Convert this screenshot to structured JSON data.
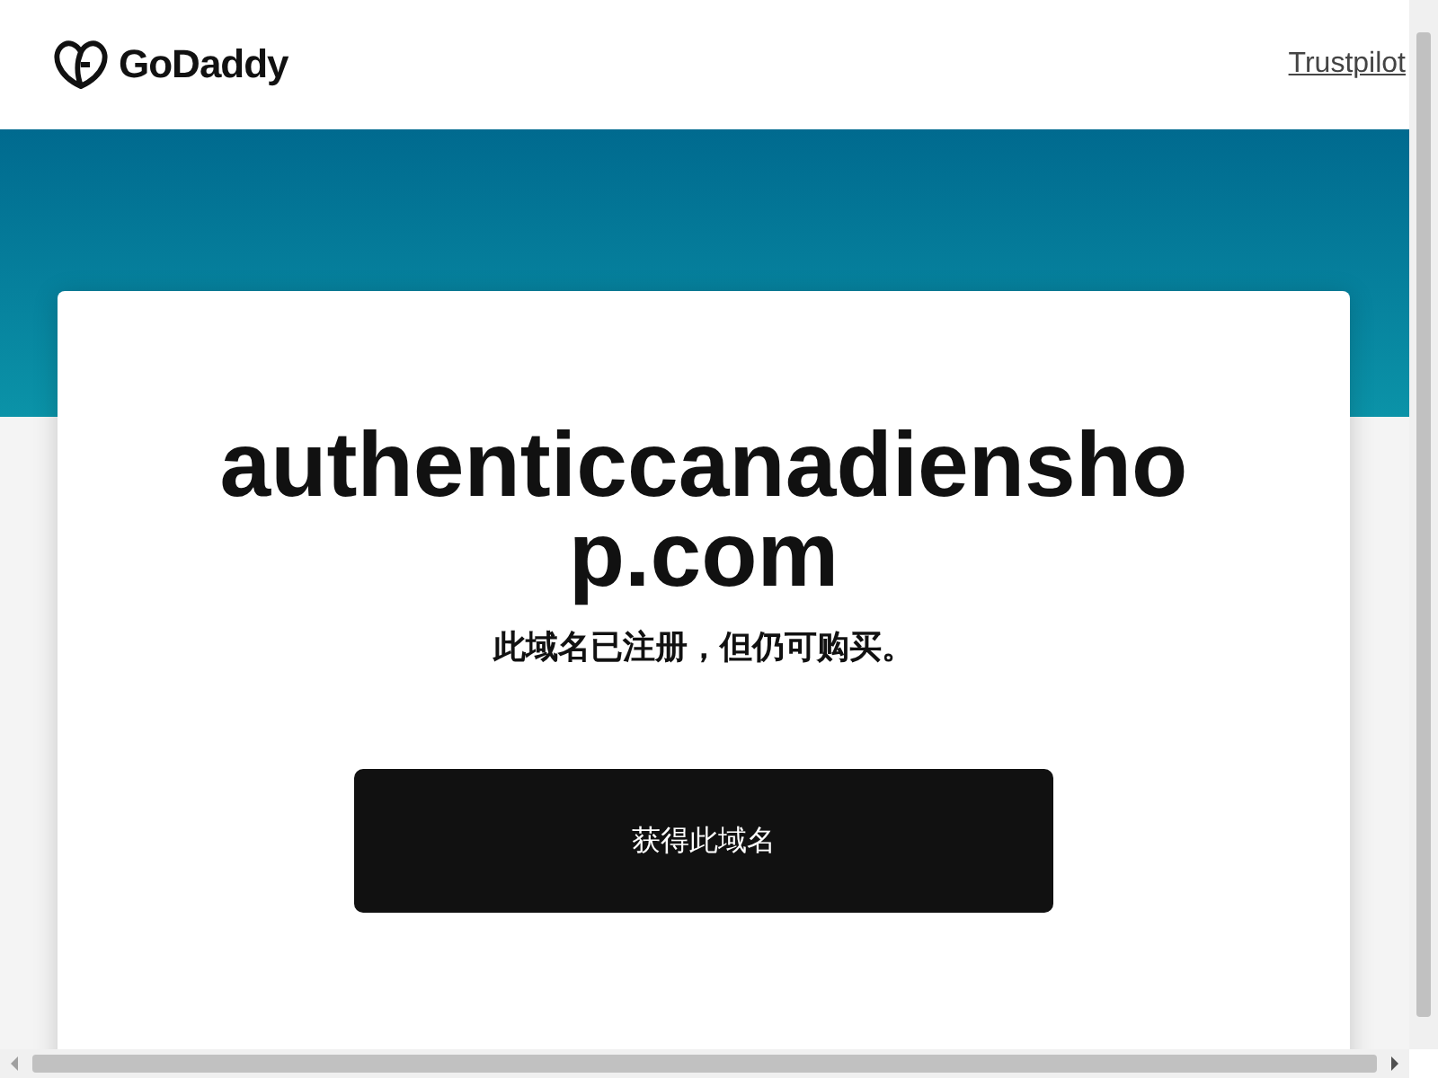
{
  "header": {
    "logo_text": "GoDaddy",
    "link": "Trustpilot"
  },
  "card": {
    "domain": "authenticcanadienshop.com",
    "subtitle": "此域名已注册，但仍可购买。",
    "button": "获得此域名"
  }
}
